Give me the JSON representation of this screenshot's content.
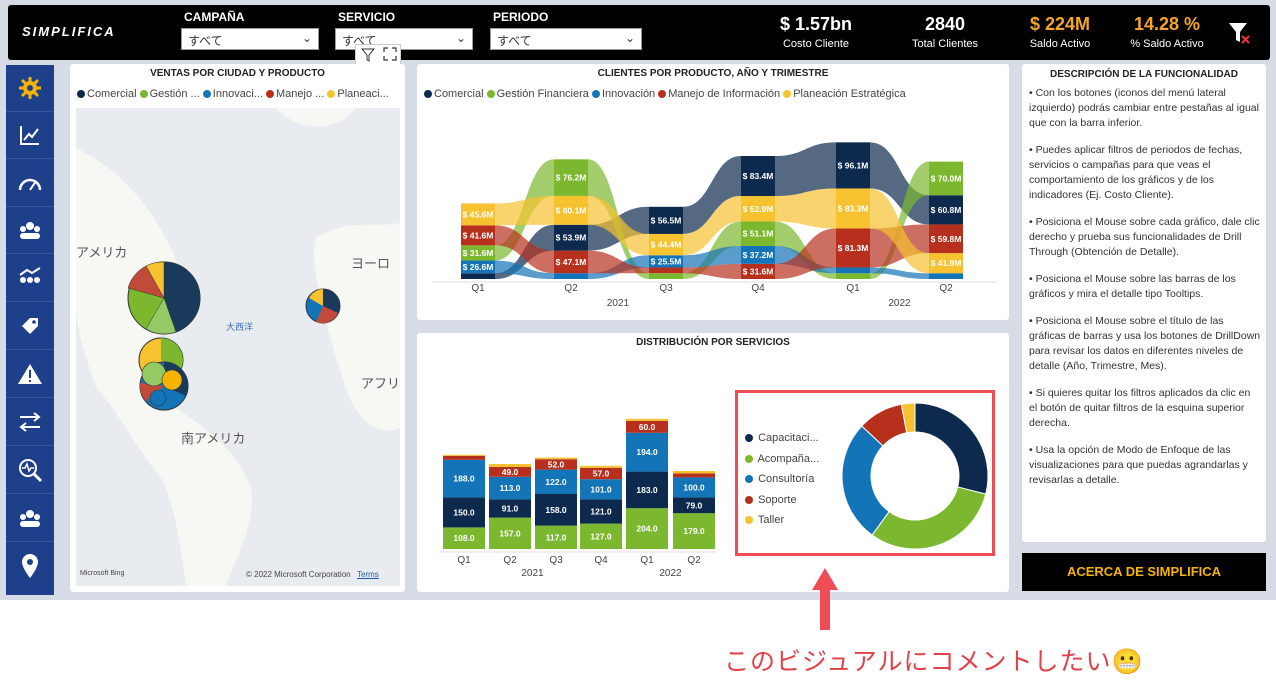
{
  "header": {
    "logo": "SIMPLIFICA",
    "filters": [
      {
        "label": "CAMPAÑA",
        "value": "すべて"
      },
      {
        "label": "SERVICIO",
        "value": "すべて"
      },
      {
        "label": "PERIODO",
        "value": "すべて"
      }
    ],
    "kpis": [
      {
        "value": "$ 1.57bn",
        "label": "Costo Cliente",
        "color": "#ffffff"
      },
      {
        "value": "2840",
        "label": "Total Clientes",
        "color": "#ffffff"
      },
      {
        "value": "$ 224M",
        "label": "Saldo Activo",
        "color": "#f5a623"
      },
      {
        "value": "14.28 %",
        "label": "% Saldo Activo",
        "color": "#f5a623"
      }
    ]
  },
  "sidebar": {
    "items": [
      "gear-icon",
      "trend-chart-icon",
      "gauge-icon",
      "team-icon",
      "people-growth-icon",
      "tag-icon",
      "warning-icon",
      "transfer-arrows-icon",
      "search-pulse-icon",
      "users-icon",
      "location-pin-icon"
    ]
  },
  "map_card": {
    "title": "VENTAS POR CIUDAD Y PRODUCTO",
    "legend": [
      {
        "label": "Comercial",
        "color": "#0d2a4e"
      },
      {
        "label": "Gestión ...",
        "color": "#7cb82f"
      },
      {
        "label": "Innovaci...",
        "color": "#1474b8"
      },
      {
        "label": "Manejo ...",
        "color": "#b7301e"
      },
      {
        "label": "Planeaci...",
        "color": "#f7c230"
      }
    ],
    "labels": {
      "america": "アメリカ",
      "atlantic": "大西洋",
      "south_america": "南アメリカ",
      "europe": "ヨーロ",
      "africa": "アフリ"
    },
    "copyright": "© 2022 Microsoft Corporation",
    "terms": "Terms",
    "bing": "Microsoft Bing"
  },
  "ribbon_card": {
    "title": "CLIENTES POR PRODUCTO, AÑO Y TRIMESTRE",
    "legend": [
      {
        "label": "Comercial",
        "color": "#0d2a4e"
      },
      {
        "label": "Gestión Financiera",
        "color": "#7cb82f"
      },
      {
        "label": "Innovación",
        "color": "#1474b8"
      },
      {
        "label": "Manejo de Información",
        "color": "#b7301e"
      },
      {
        "label": "Planeación Estratégica",
        "color": "#f7c230"
      }
    ]
  },
  "dist_card": {
    "title": "DISTRIBUCIÓN POR SERVICIOS",
    "donut_legend": [
      {
        "label": "Capacitaci...",
        "color": "#0d2a4e"
      },
      {
        "label": "Acompaña...",
        "color": "#7cb82f"
      },
      {
        "label": "Consultoría",
        "color": "#1474b8"
      },
      {
        "label": "Soporte",
        "color": "#b7301e"
      },
      {
        "label": "Taller",
        "color": "#f7c230"
      }
    ]
  },
  "description": {
    "title": "DESCRIPCIÓN DE LA FUNCIONALIDAD",
    "p1": "• Con los botones (iconos del menú lateral izquierdo) podrás cambiar entre pestañas al igual que con la barra inferior.",
    "p2": "• Puedes aplicar filtros de periodos de fechas, servicios o campañas para que veas el comportamiento de los gráficos y de los indicadores (Ej. Costo Cliente).",
    "p3": "• Posiciona el Mouse sobre cada gráfico, dale clic derecho y prueba sus funcionalidades de Drill Through (Obtención de Detalle).",
    "p4": "• Posiciona el Mouse sobre las barras de los gráficos y mira el detalle tipo Tooltips.",
    "p5": "• Posiciona el Mouse sobre el título de las gráficas de barras y usa los botones de DrillDown para revisar los datos en diferentes niveles de detalle (Año, Trimestre, Mes).",
    "p6": "• Si quieres quitar los filtros aplicados da clic en el botón de quitar filtros de la esquina superior derecha.",
    "p7": "• Usa la opción de Modo de Enfoque de las visualizaciones para que puedas agrandarlas y revisarlas a detalle.",
    "button": "ACERCA DE SIMPLIFICA"
  },
  "annotation": "このビジュアルにコメントしたい😬",
  "chart_data": [
    {
      "type": "area",
      "title": "CLIENTES POR PRODUCTO, AÑO Y TRIMESTRE",
      "categories": [
        "Q1",
        "Q2",
        "Q3",
        "Q4",
        "Q1",
        "Q2"
      ],
      "year_groups": [
        {
          "label": "2021",
          "span": [
            0,
            3
          ]
        },
        {
          "label": "2022",
          "span": [
            4,
            5
          ]
        }
      ],
      "series": [
        {
          "name": "Comercial",
          "values": [
            null,
            53.9,
            56.5,
            83.4,
            96.1,
            60.8
          ],
          "labels": [
            "",
            "$ 53.9M",
            "$ 56.5M",
            "$ 83.4M",
            "$ 96.1M",
            "$ 60.8M"
          ]
        },
        {
          "name": "Gestión Financiera",
          "values": [
            31.6,
            76.2,
            null,
            51.1,
            null,
            70.0
          ],
          "labels": [
            "$ 31.6M",
            "$ 76.2M",
            "",
            "$ 51.1M",
            "",
            "$ 70.0M"
          ]
        },
        {
          "name": "Innovación",
          "values": [
            26.6,
            null,
            25.5,
            37.2,
            null,
            null
          ],
          "labels": [
            "$ 26.6M",
            "",
            "$ 25.5M",
            "$ 37.2M",
            "",
            ""
          ]
        },
        {
          "name": "Manejo de Información",
          "values": [
            41.6,
            47.1,
            null,
            31.6,
            81.3,
            59.8
          ],
          "labels": [
            "$ 41.6M",
            "$ 47.1M",
            "",
            "$ 31.6M",
            "$ 81.3M",
            "$ 59.8M"
          ]
        },
        {
          "name": "Planeación Estratégica",
          "values": [
            45.6,
            60.1,
            44.4,
            52.9,
            83.3,
            41.9
          ],
          "labels": [
            "$ 45.6M",
            "$ 60.1M",
            "$ 44.4M",
            "$ 52.9M",
            "$ 83.3M",
            "$ 41.9M"
          ]
        }
      ]
    },
    {
      "type": "bar",
      "title": "DISTRIBUCIÓN POR SERVICIOS",
      "categories": [
        "Q1",
        "Q2",
        "Q3",
        "Q4",
        "Q1",
        "Q2"
      ],
      "year_groups": [
        {
          "label": "2021",
          "span": [
            0,
            3
          ]
        },
        {
          "label": "2022",
          "span": [
            4,
            5
          ]
        }
      ],
      "series": [
        {
          "name": "Acompaña...",
          "values": [
            108.0,
            157.0,
            117.0,
            127.0,
            204.0,
            179.0
          ]
        },
        {
          "name": "Capacitaci...",
          "values": [
            150.0,
            91.0,
            158.0,
            121.0,
            183.0,
            79.0
          ]
        },
        {
          "name": "Consultoría",
          "values": [
            188.0,
            113.0,
            122.0,
            101.0,
            194.0,
            100.0
          ]
        },
        {
          "name": "Soporte",
          "values": [
            20.0,
            49.0,
            52.0,
            57.0,
            60.0,
            20.0
          ]
        },
        {
          "name": "Taller",
          "values": [
            5.0,
            15.0,
            8.0,
            10.0,
            10.0,
            12.0
          ]
        }
      ]
    },
    {
      "type": "pie",
      "title": "DISTRIBUCIÓN POR SERVICIOS",
      "categories": [
        "Capacitaci...",
        "Acompaña...",
        "Consultoría",
        "Soporte",
        "Taller"
      ],
      "values": [
        29,
        31,
        27,
        10,
        3
      ]
    }
  ]
}
